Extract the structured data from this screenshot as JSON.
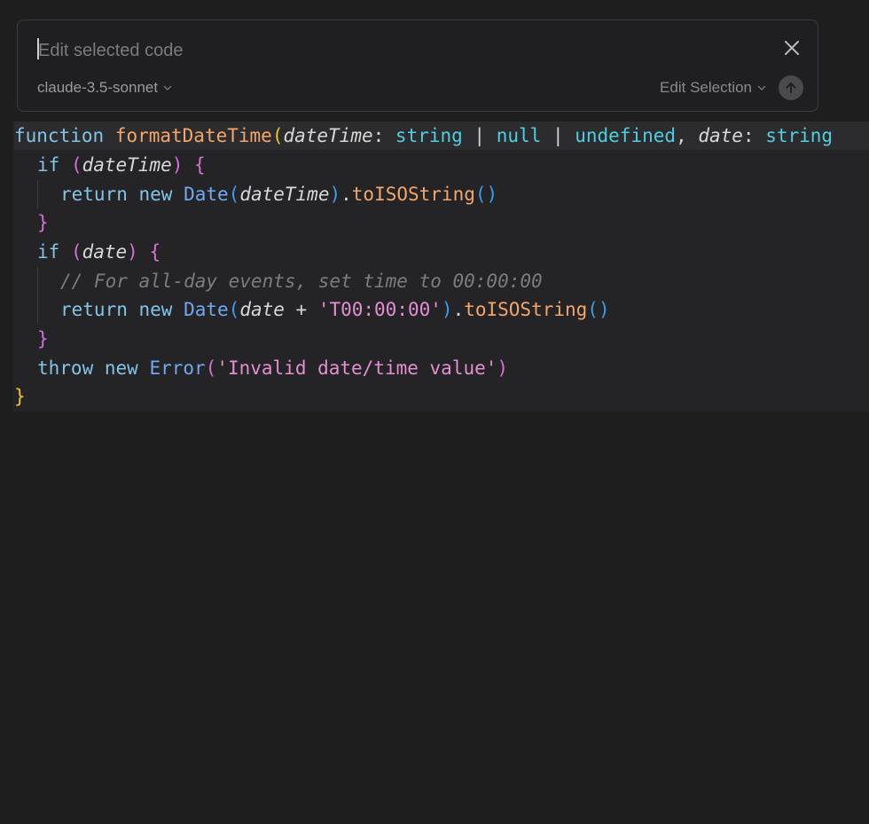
{
  "prompt": {
    "placeholder": "Edit selected code",
    "model": "claude-3.5-sonnet",
    "mode": "Edit Selection"
  },
  "code": {
    "l1": {
      "kw": "function ",
      "fn": "formatDateTime",
      "p": "(",
      "arg1": "dateTime",
      "c1": ": ",
      "t1": "string",
      "b1": " | ",
      "t2": "null",
      "b2": " | ",
      "t3": "undefined",
      "comma": ", ",
      "arg2": "date",
      "c2": ": ",
      "t4": "string"
    },
    "l2": {
      "kw": "if ",
      "p1": "(",
      "arg": "dateTime",
      "p2": ") ",
      "brace": "{"
    },
    "l3": {
      "kw": "return new ",
      "cls": "Date",
      "p1": "(",
      "arg": "dateTime",
      "p2": ")",
      "dot": ".",
      "m": "toISOString",
      "p3": "()"
    },
    "l4": {
      "brace": "}"
    },
    "l5": {
      "kw": "if ",
      "p1": "(",
      "arg": "date",
      "p2": ") ",
      "brace": "{"
    },
    "l6": {
      "cm": "// For all-day events, set time to 00:00:00"
    },
    "l7": {
      "kw": "return new ",
      "cls": "Date",
      "p1": "(",
      "arg": "date",
      "plus": " + ",
      "str": "'T00:00:00'",
      "p2": ")",
      "dot": ".",
      "m": "toISOString",
      "p3": "()"
    },
    "l8": {
      "brace": "}"
    },
    "l9": {
      "kw": "throw new ",
      "cls": "Error",
      "p1": "(",
      "str": "'Invalid date/time value'",
      "p2": ")"
    },
    "l10": {
      "brace": "}"
    }
  },
  "colors": {
    "keyword": "#83c3e6",
    "function": "#f3a66b",
    "type": "#4fcfe0",
    "string": "#e38fd1",
    "comment": "#7c7c80"
  },
  "icons": {
    "close": "close-icon",
    "model_chevron": "chevron-down-icon",
    "mode_chevron": "chevron-down-icon",
    "submit": "arrow-up-icon"
  }
}
